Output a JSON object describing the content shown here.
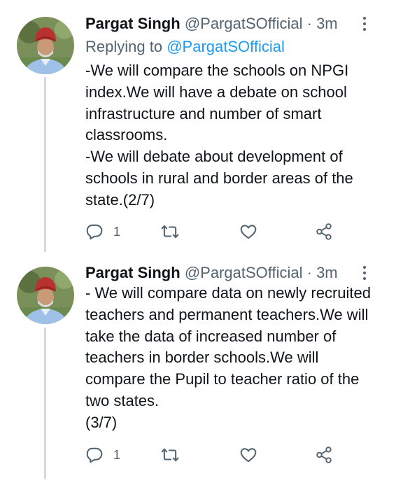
{
  "tweets": [
    {
      "author_name": "Pargat Singh",
      "handle": "@PargatSOfficial",
      "separator": "·",
      "time": "3m",
      "replying_prefix": "Replying to",
      "replying_to": "@PargatSOfficial",
      "paragraphs": [
        "-We will compare the schools on NPGI index.We will have a debate on school infrastructure and number of smart classrooms.",
        "-We will debate about development of schools in rural and border areas of the state.(2/7)"
      ],
      "reply_count": "1",
      "icons": [
        "reply-icon",
        "retweet-icon",
        "like-icon",
        "share-icon",
        "more-icon"
      ]
    },
    {
      "author_name": "Pargat Singh",
      "handle": "@PargatSOfficial",
      "separator": "·",
      "time": "3m",
      "paragraphs": [
        "- We will compare  data on newly recruited teachers and permanent teachers.We will take the data of increased number of teachers in border schools.We will compare the Pupil to teacher ratio of the two states.",
        "(3/7)"
      ],
      "reply_count": "1",
      "icons": [
        "reply-icon",
        "retweet-icon",
        "like-icon",
        "share-icon",
        "more-icon"
      ]
    }
  ],
  "colors": {
    "text": "#0f1419",
    "secondary": "#536471",
    "link": "#1d9bf0",
    "thread_line": "#cfd9de"
  }
}
